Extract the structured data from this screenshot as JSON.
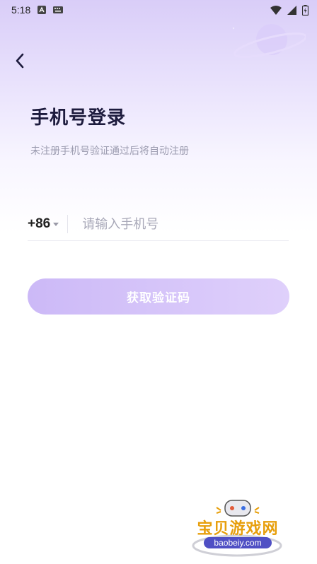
{
  "status_bar": {
    "time": "5:18"
  },
  "header": {
    "title": "手机号登录",
    "subtitle": "未注册手机号验证通过后将自动注册"
  },
  "phone": {
    "country_code": "+86",
    "value": "",
    "placeholder": "请输入手机号"
  },
  "actions": {
    "get_code_label": "获取验证码"
  },
  "watermark": {
    "title": "宝贝游戏网",
    "url": "baobeiy.com"
  },
  "colors": {
    "accent": "#c8b4f5",
    "title": "#1d1b3d",
    "subtitle": "#9c9cb0"
  }
}
